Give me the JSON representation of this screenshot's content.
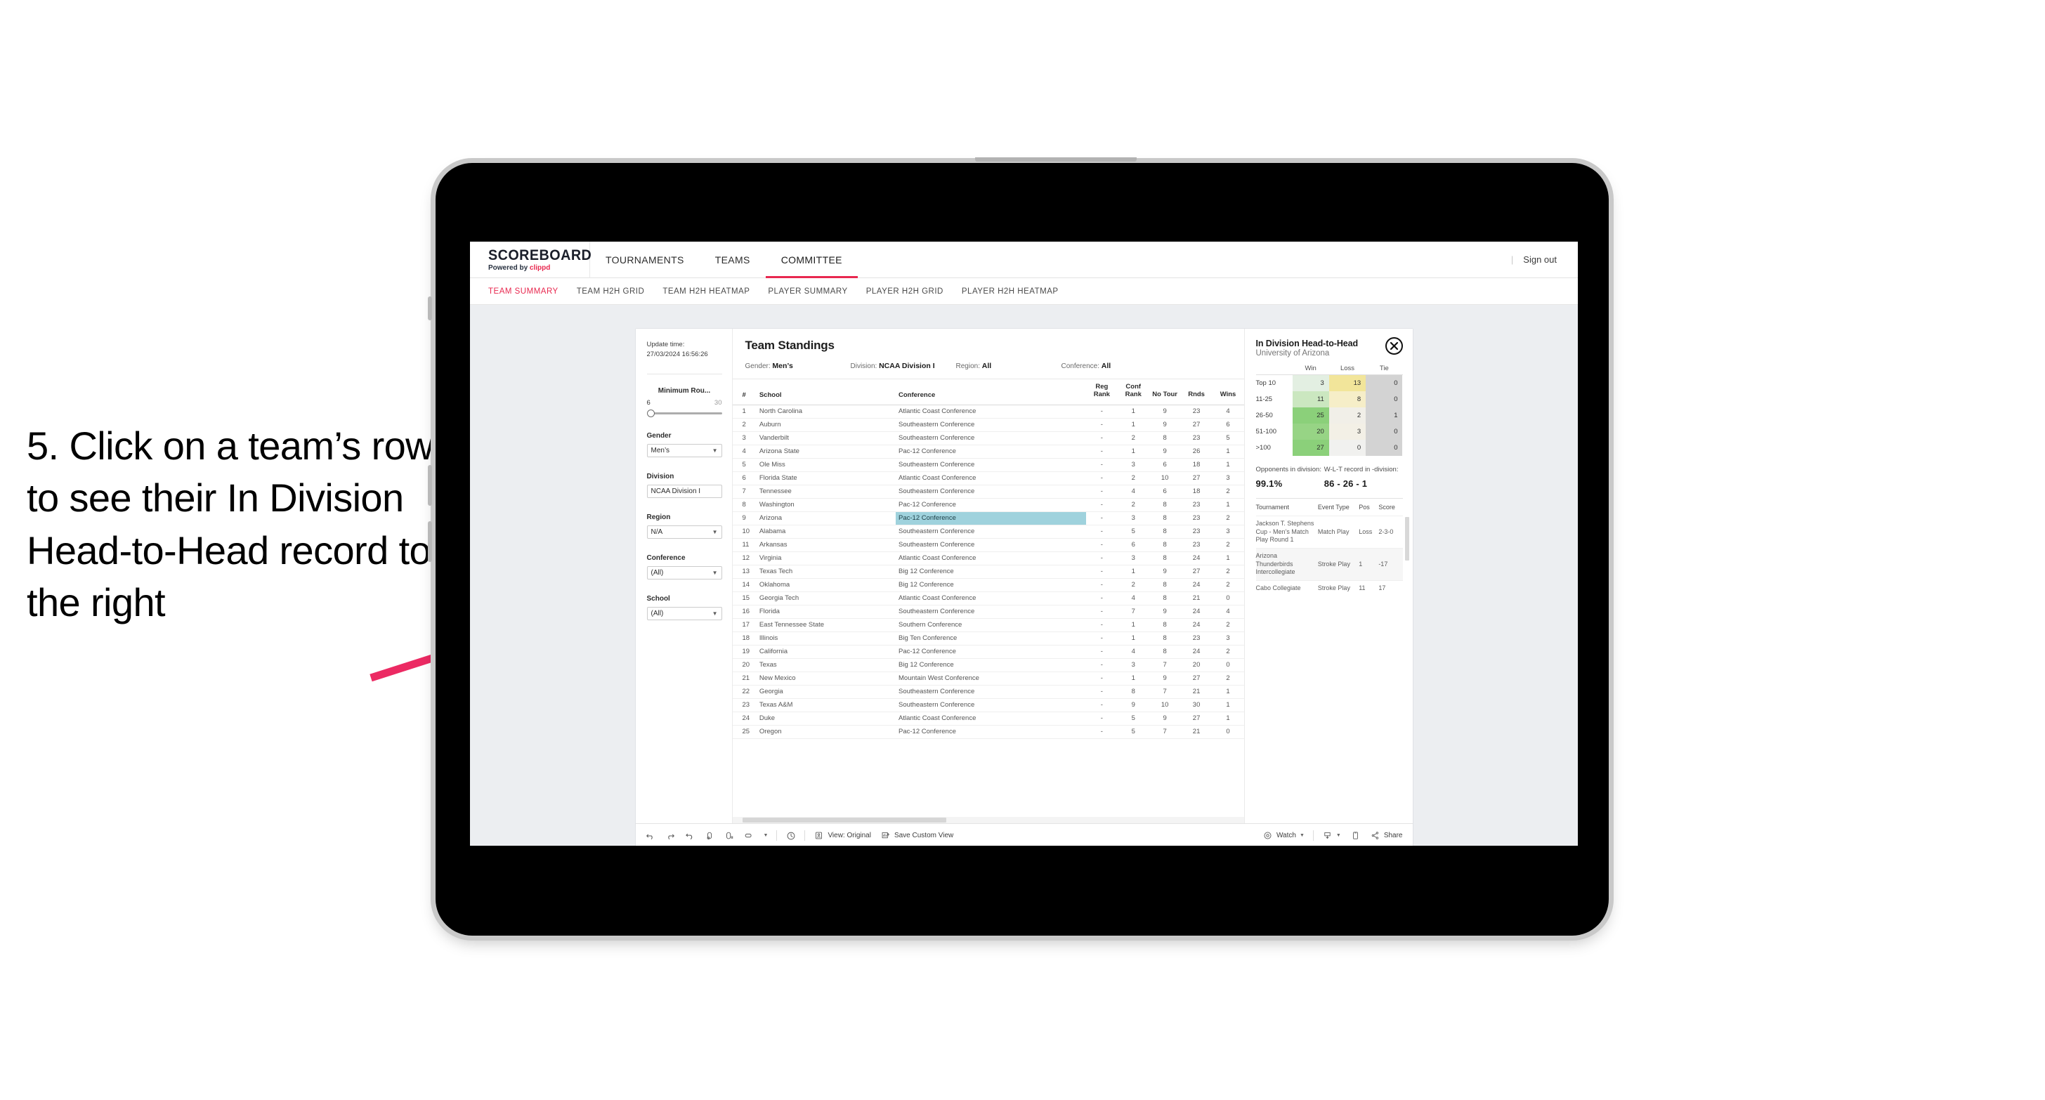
{
  "annotation": {
    "text": "5. Click on a team’s row to see their In Division Head-to-Head record to the right",
    "arrow_color": "#ec2a63"
  },
  "appbar": {
    "logo": "SCOREBOARD",
    "powered_by_prefix": "Powered by ",
    "powered_by_brand": "clippd",
    "nav": [
      {
        "label": "TOURNAMENTS",
        "active": false
      },
      {
        "label": "TEAMS",
        "active": false
      },
      {
        "label": "COMMITTEE",
        "active": true
      }
    ],
    "divider": "|",
    "sign_out": "Sign out",
    "accent": "#e8284f"
  },
  "subnav": {
    "items": [
      {
        "label": "TEAM SUMMARY",
        "active": true
      },
      {
        "label": "TEAM H2H GRID",
        "active": false
      },
      {
        "label": "TEAM H2H HEATMAP",
        "active": false
      },
      {
        "label": "PLAYER SUMMARY",
        "active": false
      },
      {
        "label": "PLAYER H2H GRID",
        "active": false
      },
      {
        "label": "PLAYER H2H HEATMAP",
        "active": false
      }
    ]
  },
  "filters": {
    "update_label": "Update time:",
    "update_value": "27/03/2024 16:56:26",
    "min_rounds": {
      "title": "Minimum Rou...",
      "low": "6",
      "high": "30"
    },
    "gender": {
      "title": "Gender",
      "value": "Men’s"
    },
    "division": {
      "title": "Division",
      "value": "NCAA Division I"
    },
    "region": {
      "title": "Region",
      "value": "N/A"
    },
    "conference": {
      "title": "Conference",
      "value": "(All)"
    },
    "school": {
      "title": "School",
      "value": "(All)"
    }
  },
  "standings": {
    "title": "Team Standings",
    "meta": [
      {
        "label": "Gender: ",
        "value": "Men’s"
      },
      {
        "label": "Division: ",
        "value": "NCAA Division I"
      },
      {
        "label": "Region: ",
        "value": "All"
      },
      {
        "label": "Conference: ",
        "value": "All"
      }
    ],
    "columns": [
      "#",
      "School",
      "Conference",
      "Reg Rank",
      "Conf Rank",
      "No Tour",
      "Rnds",
      "Wins"
    ],
    "rows": [
      {
        "num": "1",
        "school": "North Carolina",
        "conference": "Atlantic Coast Conference",
        "reg_rank": "-",
        "conf_rank": "1",
        "no_tour": "9",
        "rnds": "23",
        "wins": "4",
        "highlight": false
      },
      {
        "num": "2",
        "school": "Auburn",
        "conference": "Southeastern Conference",
        "reg_rank": "-",
        "conf_rank": "1",
        "no_tour": "9",
        "rnds": "27",
        "wins": "6",
        "highlight": false
      },
      {
        "num": "3",
        "school": "Vanderbilt",
        "conference": "Southeastern Conference",
        "reg_rank": "-",
        "conf_rank": "2",
        "no_tour": "8",
        "rnds": "23",
        "wins": "5",
        "highlight": false
      },
      {
        "num": "4",
        "school": "Arizona State",
        "conference": "Pac-12 Conference",
        "reg_rank": "-",
        "conf_rank": "1",
        "no_tour": "9",
        "rnds": "26",
        "wins": "1",
        "highlight": false
      },
      {
        "num": "5",
        "school": "Ole Miss",
        "conference": "Southeastern Conference",
        "reg_rank": "-",
        "conf_rank": "3",
        "no_tour": "6",
        "rnds": "18",
        "wins": "1",
        "highlight": false
      },
      {
        "num": "6",
        "school": "Florida State",
        "conference": "Atlantic Coast Conference",
        "reg_rank": "-",
        "conf_rank": "2",
        "no_tour": "10",
        "rnds": "27",
        "wins": "3",
        "highlight": false
      },
      {
        "num": "7",
        "school": "Tennessee",
        "conference": "Southeastern Conference",
        "reg_rank": "-",
        "conf_rank": "4",
        "no_tour": "6",
        "rnds": "18",
        "wins": "2",
        "highlight": false
      },
      {
        "num": "8",
        "school": "Washington",
        "conference": "Pac-12 Conference",
        "reg_rank": "-",
        "conf_rank": "2",
        "no_tour": "8",
        "rnds": "23",
        "wins": "1",
        "highlight": false
      },
      {
        "num": "9",
        "school": "Arizona",
        "conference": "Pac-12 Conference",
        "reg_rank": "-",
        "conf_rank": "3",
        "no_tour": "8",
        "rnds": "23",
        "wins": "2",
        "highlight": true
      },
      {
        "num": "10",
        "school": "Alabama",
        "conference": "Southeastern Conference",
        "reg_rank": "-",
        "conf_rank": "5",
        "no_tour": "8",
        "rnds": "23",
        "wins": "3",
        "highlight": false
      },
      {
        "num": "11",
        "school": "Arkansas",
        "conference": "Southeastern Conference",
        "reg_rank": "-",
        "conf_rank": "6",
        "no_tour": "8",
        "rnds": "23",
        "wins": "2",
        "highlight": false
      },
      {
        "num": "12",
        "school": "Virginia",
        "conference": "Atlantic Coast Conference",
        "reg_rank": "-",
        "conf_rank": "3",
        "no_tour": "8",
        "rnds": "24",
        "wins": "1",
        "highlight": false
      },
      {
        "num": "13",
        "school": "Texas Tech",
        "conference": "Big 12 Conference",
        "reg_rank": "-",
        "conf_rank": "1",
        "no_tour": "9",
        "rnds": "27",
        "wins": "2",
        "highlight": false
      },
      {
        "num": "14",
        "school": "Oklahoma",
        "conference": "Big 12 Conference",
        "reg_rank": "-",
        "conf_rank": "2",
        "no_tour": "8",
        "rnds": "24",
        "wins": "2",
        "highlight": false
      },
      {
        "num": "15",
        "school": "Georgia Tech",
        "conference": "Atlantic Coast Conference",
        "reg_rank": "-",
        "conf_rank": "4",
        "no_tour": "8",
        "rnds": "21",
        "wins": "0",
        "highlight": false
      },
      {
        "num": "16",
        "school": "Florida",
        "conference": "Southeastern Conference",
        "reg_rank": "-",
        "conf_rank": "7",
        "no_tour": "9",
        "rnds": "24",
        "wins": "4",
        "highlight": false
      },
      {
        "num": "17",
        "school": "East Tennessee State",
        "conference": "Southern Conference",
        "reg_rank": "-",
        "conf_rank": "1",
        "no_tour": "8",
        "rnds": "24",
        "wins": "2",
        "highlight": false
      },
      {
        "num": "18",
        "school": "Illinois",
        "conference": "Big Ten Conference",
        "reg_rank": "-",
        "conf_rank": "1",
        "no_tour": "8",
        "rnds": "23",
        "wins": "3",
        "highlight": false
      },
      {
        "num": "19",
        "school": "California",
        "conference": "Pac-12 Conference",
        "reg_rank": "-",
        "conf_rank": "4",
        "no_tour": "8",
        "rnds": "24",
        "wins": "2",
        "highlight": false
      },
      {
        "num": "20",
        "school": "Texas",
        "conference": "Big 12 Conference",
        "reg_rank": "-",
        "conf_rank": "3",
        "no_tour": "7",
        "rnds": "20",
        "wins": "0",
        "highlight": false
      },
      {
        "num": "21",
        "school": "New Mexico",
        "conference": "Mountain West Conference",
        "reg_rank": "-",
        "conf_rank": "1",
        "no_tour": "9",
        "rnds": "27",
        "wins": "2",
        "highlight": false
      },
      {
        "num": "22",
        "school": "Georgia",
        "conference": "Southeastern Conference",
        "reg_rank": "-",
        "conf_rank": "8",
        "no_tour": "7",
        "rnds": "21",
        "wins": "1",
        "highlight": false
      },
      {
        "num": "23",
        "school": "Texas A&M",
        "conference": "Southeastern Conference",
        "reg_rank": "-",
        "conf_rank": "9",
        "no_tour": "10",
        "rnds": "30",
        "wins": "1",
        "highlight": false
      },
      {
        "num": "24",
        "school": "Duke",
        "conference": "Atlantic Coast Conference",
        "reg_rank": "-",
        "conf_rank": "5",
        "no_tour": "9",
        "rnds": "27",
        "wins": "1",
        "highlight": false
      },
      {
        "num": "25",
        "school": "Oregon",
        "conference": "Pac-12 Conference",
        "reg_rank": "-",
        "conf_rank": "5",
        "no_tour": "7",
        "rnds": "21",
        "wins": "0",
        "highlight": false
      }
    ],
    "highlight_color": "#9fd2dd"
  },
  "h2h": {
    "title": "In Division Head-to-Head",
    "subtitle": "University of Arizona",
    "close_icon": "close-circle-icon",
    "heatmap": {
      "columns": [
        "Win",
        "Loss",
        "Tie"
      ],
      "rows": [
        {
          "label": "Top 10",
          "win": "3",
          "loss": "13",
          "tie": "0",
          "win_color": "#e3efe2",
          "loss_color": "#f2e59a",
          "tie_color": "#d3d3d3"
        },
        {
          "label": "11-25",
          "win": "11",
          "loss": "8",
          "tie": "0",
          "win_color": "#cbe7c0",
          "loss_color": "#f6eec8",
          "tie_color": "#d3d3d3"
        },
        {
          "label": "26-50",
          "win": "25",
          "loss": "2",
          "tie": "1",
          "win_color": "#8bd07a",
          "loss_color": "#f1efe8",
          "tie_color": "#d3d3d3"
        },
        {
          "label": "51-100",
          "win": "20",
          "loss": "3",
          "tie": "0",
          "win_color": "#97d485",
          "loss_color": "#f3f0e6",
          "tie_color": "#d3d3d3"
        },
        {
          "label": ">100",
          "win": "27",
          "loss": "0",
          "tie": "0",
          "win_color": "#8bd07a",
          "loss_color": "#f1f1ef",
          "tie_color": "#d3d3d3"
        }
      ]
    },
    "stats": [
      {
        "caption": "Opponents in division:",
        "value": "99.1%"
      },
      {
        "caption": "W-L-T record in -division:",
        "value": "86 - 26 - 1"
      }
    ],
    "tournaments": {
      "columns": [
        "Tournament",
        "Event Type",
        "Pos",
        "Score"
      ],
      "rows": [
        {
          "name": "Jackson T. Stephens Cup - Men’s Match Play Round 1",
          "event_type": "Match Play",
          "pos": "Loss",
          "score": "2-3-0"
        },
        {
          "name": "Arizona Thunderbirds Intercollegiate",
          "event_type": "Stroke Play",
          "pos": "1",
          "score": "-17"
        },
        {
          "name": "Cabo Collegiate",
          "event_type": "Stroke Play",
          "pos": "11",
          "score": "17"
        }
      ]
    }
  },
  "viz_toolbar": {
    "icons": [
      "undo-icon",
      "redo-icon",
      "revert-icon",
      "refresh-data-icon",
      "pause-updates-icon",
      "rectangle-select-icon"
    ],
    "history_icon": "history-icon",
    "view_label": "View: Original",
    "view_icon": "view-original-icon",
    "save_label": "Save Custom View",
    "save_icon": "save-view-icon",
    "watch_label": "Watch",
    "watch_icon": "watch-icon",
    "download_icon": "download-icon",
    "device_icon": "device-preview-icon",
    "share_label": "Share",
    "share_icon": "share-icon"
  }
}
